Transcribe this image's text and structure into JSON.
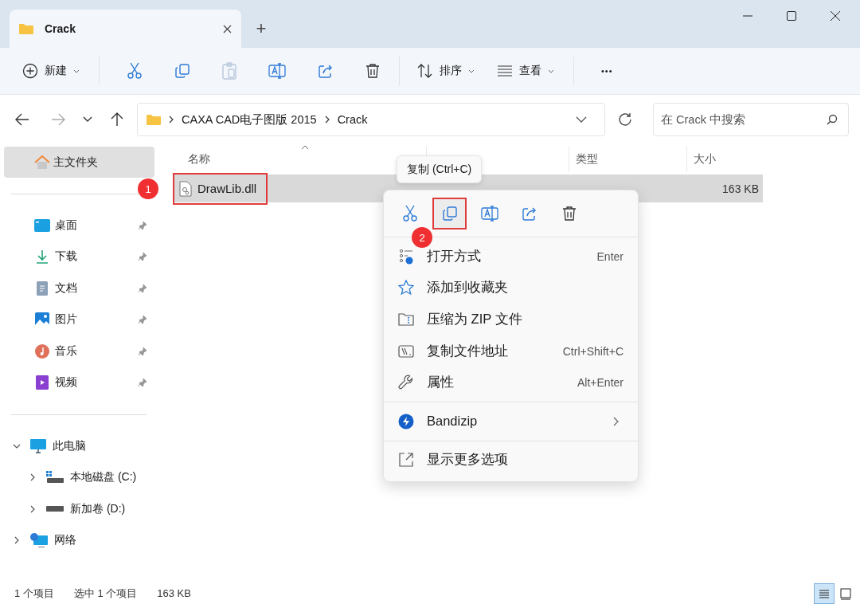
{
  "window": {
    "tab_title": "Crack",
    "new_tab": "+"
  },
  "toolbar": {
    "new": "新建",
    "sort": "排序",
    "view": "查看",
    "more": "•••"
  },
  "address": {
    "path": [
      "CAXA CAD电子图版 2015",
      "Crack"
    ],
    "search_placeholder": "在 Crack 中搜索"
  },
  "sidebar": {
    "home": {
      "label": "主文件夹",
      "selected": true
    },
    "quick_access": [
      {
        "label": "桌面",
        "kind": "desktop"
      },
      {
        "label": "下载",
        "kind": "download"
      },
      {
        "label": "文档",
        "kind": "document"
      },
      {
        "label": "图片",
        "kind": "picture"
      },
      {
        "label": "音乐",
        "kind": "music"
      },
      {
        "label": "视频",
        "kind": "video"
      }
    ],
    "tree": [
      {
        "label": "此电脑",
        "kind": "pc",
        "expanded": true,
        "children": [
          {
            "label": "本地磁盘 (C:)",
            "kind": "drive-c",
            "expanded": false
          },
          {
            "label": "新加卷 (D:)",
            "kind": "drive",
            "expanded": false
          }
        ]
      },
      {
        "label": "网络",
        "kind": "network",
        "expanded": false
      }
    ]
  },
  "columns": {
    "name": "名称",
    "type": "类型",
    "size": "大小"
  },
  "files": [
    {
      "name": "DrawLib.dll",
      "size": "163 KB",
      "selected": true,
      "callout": "1"
    }
  ],
  "tooltip": "复制 (Ctrl+C)",
  "context_menu": {
    "actions": [
      {
        "kind": "cut"
      },
      {
        "kind": "copy",
        "callout": "2"
      },
      {
        "kind": "rename"
      },
      {
        "kind": "share"
      },
      {
        "kind": "delete"
      }
    ],
    "groups": [
      [
        {
          "kind": "open-with",
          "label": "打开方式",
          "shortcut": "Enter"
        },
        {
          "kind": "favorite",
          "label": "添加到收藏夹"
        },
        {
          "kind": "zip",
          "label": "压缩为 ZIP 文件"
        },
        {
          "kind": "copy-path",
          "label": "复制文件地址",
          "shortcut": "Ctrl+Shift+C"
        },
        {
          "kind": "properties",
          "label": "属性",
          "shortcut": "Alt+Enter"
        }
      ],
      [
        {
          "kind": "bandizip",
          "label": "Bandizip",
          "submenu": true
        }
      ],
      [
        {
          "kind": "more-options",
          "label": "显示更多选项"
        }
      ]
    ]
  },
  "status_bar": {
    "count": "1 个项目",
    "selection": "选中 1 个项目",
    "selection_size": "163 KB",
    "view_buttons": [
      {
        "kind": "details",
        "selected": true
      },
      {
        "kind": "tiles",
        "selected": false
      }
    ]
  }
}
